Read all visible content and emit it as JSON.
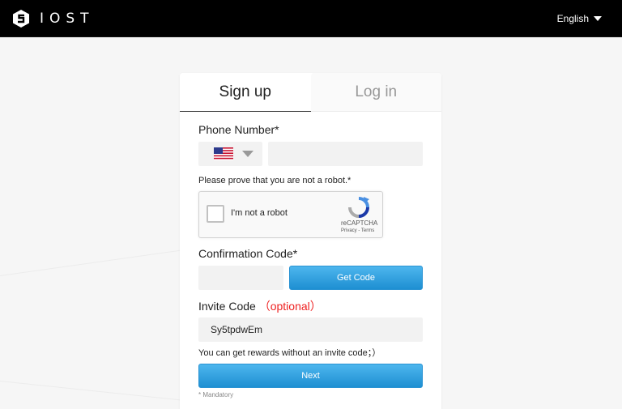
{
  "header": {
    "brand_name": "IOST",
    "language": "English"
  },
  "tabs": [
    {
      "label": "Sign up",
      "active": true
    },
    {
      "label": "Log in",
      "active": false
    }
  ],
  "form": {
    "phone_label": "Phone Number*",
    "phone_value": "",
    "country_flag": "us-flag-icon",
    "robot_prompt": "Please prove that you are not a robot.*",
    "captcha": {
      "checkbox_label": "I'm not a robot",
      "brand": "reCAPTCHA",
      "links": "Privacy - Terms"
    },
    "confirmation_label": "Confirmation Code*",
    "confirmation_value": "",
    "get_code_label": "Get Code",
    "invite_label": "Invite Code",
    "invite_optional": "（optional）",
    "invite_value": "Sy5tpdwEm",
    "invite_hint": "You can get rewards without an invite code；）",
    "next_label": "Next",
    "mandatory_note": "* Mandatory"
  },
  "colors": {
    "header_bg": "#000000",
    "button_accent": "#2a93d3",
    "optional_text": "#ee2222"
  }
}
